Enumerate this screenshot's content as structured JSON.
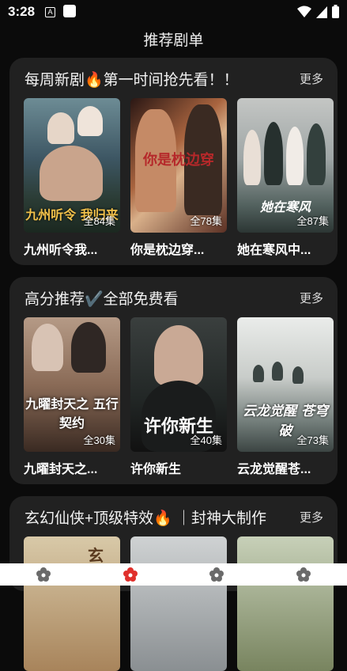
{
  "status": {
    "time": "3:28",
    "notif_letter": "A"
  },
  "page": {
    "title": "推荐剧单"
  },
  "sections": [
    {
      "title": "每周新剧🔥第一时间抢先看！！",
      "more": "更多",
      "cards": [
        {
          "title": "九州听令我...",
          "episodes": "全84集",
          "poster_text": "九州听令 我归来"
        },
        {
          "title": "你是枕边穿...",
          "episodes": "全78集",
          "poster_text": "你是枕边穿"
        },
        {
          "title": "她在寒风中...",
          "episodes": "全87集",
          "poster_text": "她在寒风"
        }
      ]
    },
    {
      "title": "高分推荐✔️全部免费看",
      "more": "更多",
      "cards": [
        {
          "title": "九曜封天之...",
          "episodes": "全30集",
          "poster_text": "九曜封天之 五行契约"
        },
        {
          "title": "许你新生",
          "episodes": "全40集",
          "poster_text": "许你新生"
        },
        {
          "title": "云龙觉醒苍...",
          "episodes": "全73集",
          "poster_text": "云龙觉醒 苍穹破"
        }
      ]
    },
    {
      "title": "玄幻仙侠+顶级特效🔥 ｜封神大制作",
      "more": "更多",
      "cards": [
        {
          "title": "",
          "episodes": "",
          "poster_text": "玄"
        },
        {
          "title": "",
          "episodes": "",
          "poster_text": ""
        },
        {
          "title": "",
          "episodes": "",
          "poster_text": ""
        }
      ]
    }
  ],
  "bottom_nav": [
    {
      "icon": "flower-icon",
      "active": false
    },
    {
      "icon": "flower-icon",
      "active": true
    },
    {
      "icon": "flower-icon",
      "active": false
    },
    {
      "icon": "flower-icon",
      "active": false
    }
  ],
  "colors": {
    "background": "#0b0b0b",
    "card_bg": "#212121",
    "nav_active": "#e0302c",
    "nav_inactive": "#666666"
  }
}
